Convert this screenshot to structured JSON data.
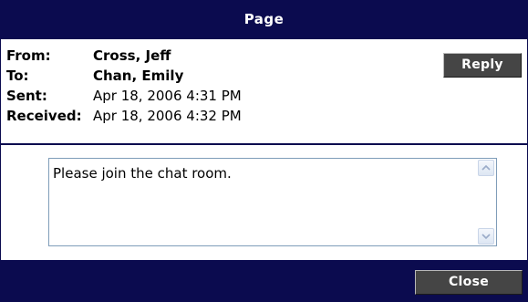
{
  "window": {
    "title": "Page"
  },
  "header": {
    "from_label": "From:",
    "from_value": "Cross, Jeff",
    "to_label": "To:",
    "to_value": "Chan, Emily",
    "sent_label": "Sent:",
    "sent_value": "Apr 18, 2006 4:31 PM",
    "received_label": "Received:",
    "received_value": "Apr 18, 2006 4:32 PM"
  },
  "actions": {
    "reply_label": "Reply",
    "close_label": "Close"
  },
  "message": {
    "body": "Please join the chat room."
  },
  "colors": {
    "title_bar": "#0b0b4f",
    "button": "#454545",
    "textbox_border": "#7f9db9"
  },
  "icons": {
    "scroll_up": "scroll-up-arrow-icon",
    "scroll_down": "scroll-down-arrow-icon"
  }
}
